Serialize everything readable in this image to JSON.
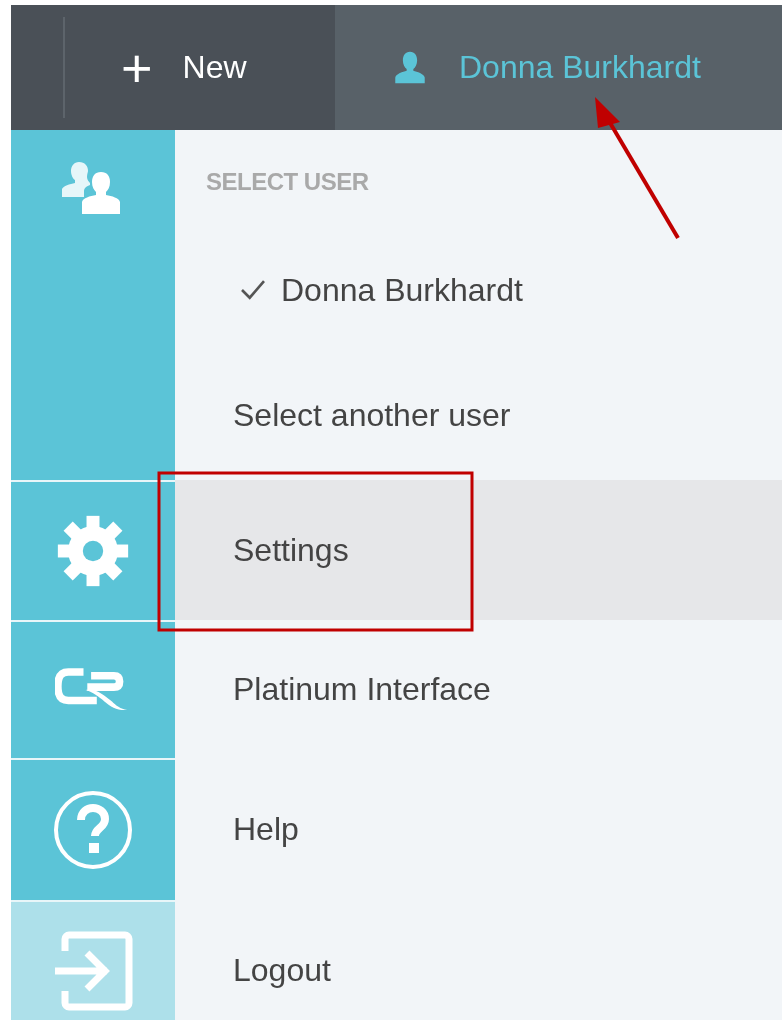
{
  "top_bar": {
    "new_button": {
      "icon": "+",
      "label": "New"
    },
    "user": {
      "name": "Donna Burkhardt"
    }
  },
  "sidebar": {
    "items": [
      {
        "kind": "users"
      },
      {
        "kind": "settings"
      },
      {
        "kind": "logo"
      },
      {
        "kind": "help"
      },
      {
        "kind": "logout"
      }
    ]
  },
  "menu": {
    "header": "SELECT USER",
    "items": [
      {
        "label": "Donna Burkhardt",
        "checked": true,
        "selected": false
      },
      {
        "label": "Select another user",
        "checked": false,
        "selected": false
      },
      {
        "label": "Settings",
        "checked": false,
        "selected": true
      },
      {
        "label": "Platinum Interface",
        "checked": false,
        "selected": false
      },
      {
        "label": "Help",
        "checked": false,
        "selected": false
      },
      {
        "label": "Logout",
        "checked": false,
        "selected": false
      }
    ]
  }
}
